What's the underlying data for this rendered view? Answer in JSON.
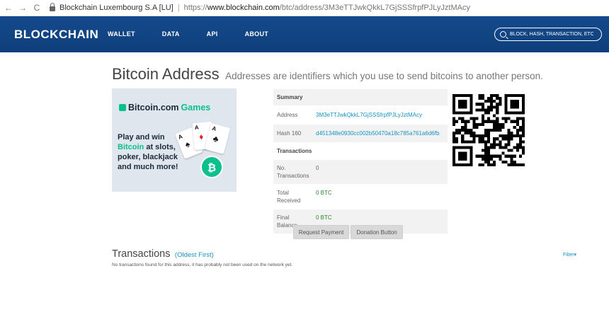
{
  "browser": {
    "back": "←",
    "forward": "→",
    "reload": "C",
    "site_name": "Blockchain Luxembourg S.A [LU]",
    "separator": "|",
    "url_scheme": "https://",
    "url_host": "www.blockchain.com",
    "url_path": "/btc/address/3M3eTTJwkQkkL7GjSSSfrpfPJLyJztMAcy"
  },
  "header": {
    "logo": "BLOCKCHAIN",
    "nav": [
      "WALLET",
      "DATA",
      "API",
      "ABOUT"
    ],
    "search_placeholder": "BLOCK, HASH, TRANSACTION, ETC...",
    "colors": {
      "bar": "#134a8d"
    }
  },
  "page": {
    "title": "Bitcoin Address",
    "subtitle": "Addresses are identifiers which you use to send bitcoins to another person."
  },
  "ad": {
    "brand": "Bitcoin.com",
    "brand_suffix": "Games",
    "line1": "Play and win",
    "line2_hl": "Bitcoin",
    "line2_rest": " at slots,",
    "line3": "poker, blackjack",
    "line4": "and much more!",
    "cards": [
      {
        "index": "A",
        "suit": "♠"
      },
      {
        "index": "A",
        "suit": "♦"
      },
      {
        "index": "A",
        "suit": "♣"
      }
    ],
    "chip": "₿",
    "colors": {
      "accent": "#0ac18e"
    }
  },
  "summary": {
    "header": "Summary",
    "address_label": "Address",
    "address": "3M3eTTJwkQkkL7GjSSSfrpfPJLyJztMAcy",
    "hash_label": "Hash 160",
    "hash": "d451348e0930cc002b50470a18c785a761a6d6fb",
    "tx_header": "Transactions",
    "no_tx_label_1": "No.",
    "no_tx_label_2": "Transactions",
    "no_tx": "0",
    "total_received_label_1": "Total",
    "total_received_label_2": "Received",
    "total_received": "0 BTC",
    "final_balance_label_1": "Final",
    "final_balance_label_2": "Balance",
    "final_balance": "0 BTC"
  },
  "buttons": {
    "request_payment": "Request Payment",
    "donation_button": "Donation Button"
  },
  "transactions": {
    "title": "Transactions",
    "order": "(Oldest First)",
    "filter": "Filter▾",
    "empty_message": "No transactions found for this address, it has probably not been used on the network yet."
  }
}
